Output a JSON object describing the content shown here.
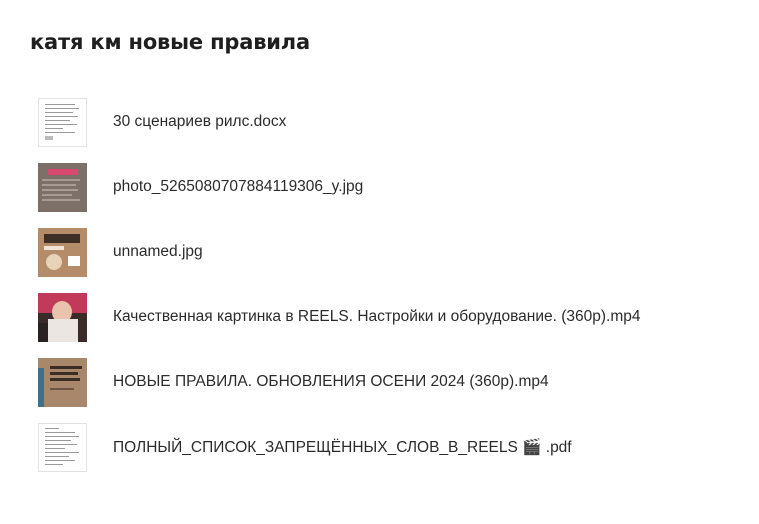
{
  "folder": {
    "title": "катя км новые правила"
  },
  "files": [
    {
      "name": "30 сценариев рилс.docx",
      "icon": "document-thumbnail"
    },
    {
      "name": "photo_5265080707884119306_y.jpg",
      "icon": "image-thumbnail"
    },
    {
      "name": "unnamed.jpg",
      "icon": "image-thumbnail"
    },
    {
      "name": "Качественная картинка в REELS. Настройки и оборудование. (360p).mp4",
      "icon": "video-thumbnail"
    },
    {
      "name": "НОВЫЕ ПРАВИЛА. ОБНОВЛЕНИЯ ОСЕНИ 2024 (360p).mp4",
      "icon": "video-thumbnail"
    },
    {
      "name": "ПОЛНЫЙ_СПИСОК_ЗАПРЕЩЁННЫХ_СЛОВ_В_REELS 🎬 .pdf",
      "icon": "document-thumbnail"
    }
  ]
}
